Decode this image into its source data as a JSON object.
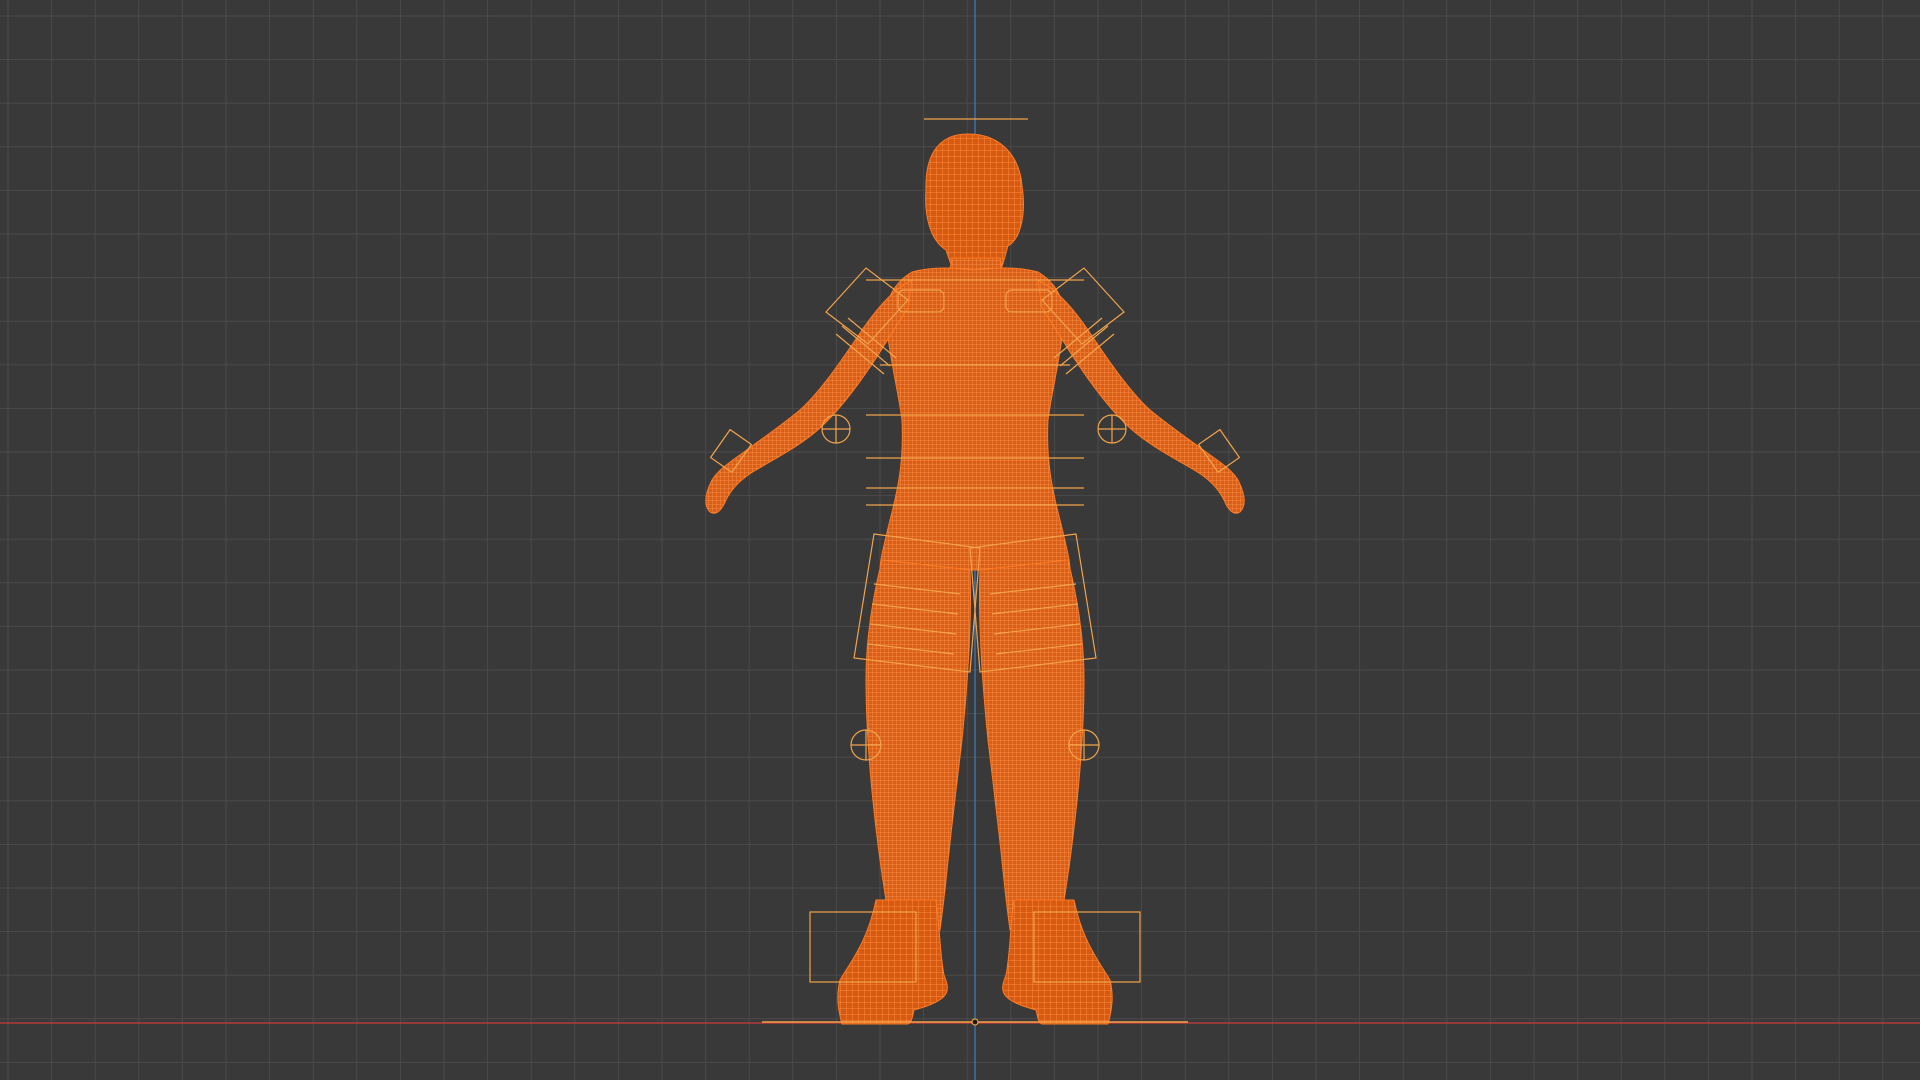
{
  "viewport": {
    "view": "front-orthographic",
    "shading": "wireframe",
    "background_color": "#393939",
    "grid": {
      "visible": true,
      "color": "#4a4a4a"
    },
    "axes": {
      "x_axis_color": "#b43a3a",
      "z_axis_color": "#3d7fc0"
    }
  },
  "scene_object": {
    "name_icon": "humanoid-mesh",
    "type": "mesh-with-armature",
    "pose": "A-pose",
    "selected": true,
    "selection_color": "#ff6a00",
    "mesh_color": "#e8661a",
    "control_color": "#f2a34a"
  },
  "rig_controls": {
    "pole_targets": [
      "elbow-left",
      "elbow-right",
      "knee-left",
      "knee-right"
    ],
    "foot_controls": [
      "foot-left",
      "foot-right"
    ],
    "root_control": "root-line"
  }
}
